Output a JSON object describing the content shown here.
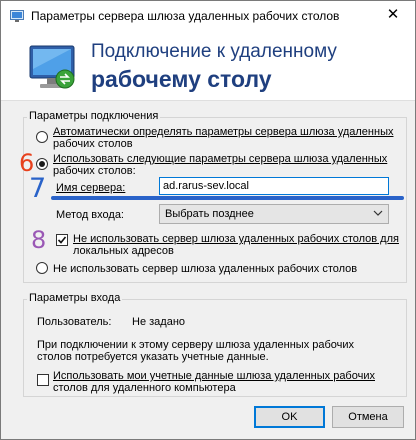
{
  "window": {
    "title": "Параметры сервера шлюза удаленных рабочих столов",
    "close_symbol": "✕"
  },
  "banner": {
    "line1": "Подключение к удаленному",
    "line2": "рабочему столу",
    "icon": "remote-desktop-monitor-icon"
  },
  "connection": {
    "group_title": "Параметры подключения",
    "option_auto": [
      "Автоматически определять параметры сервера шлюза удаленных",
      "рабочих столов"
    ],
    "option_use": [
      "Использовать следующие параметры сервера шлюза удаленных",
      "рабочих столов:"
    ],
    "server_name_label": "Имя сервера:",
    "server_name_value": "ad.rarus-sev.local",
    "login_method_label": "Метод входа:",
    "login_method_value": "Выбрать позднее",
    "bypass_local": [
      "Не использовать сервер шлюза удаленных рабочих столов для",
      "локальных адресов"
    ],
    "option_none": "Не использовать сервер шлюза удаленных рабочих столов",
    "selected_option": "use",
    "bypass_local_checked": true
  },
  "annotations": {
    "n6": "6",
    "n7": "7",
    "n8": "8",
    "colors": {
      "n6": "#e8401c",
      "n7": "#2a63c9",
      "n8": "#9a58b5"
    }
  },
  "login": {
    "group_title": "Параметры входа",
    "user_label": "Пользователь:",
    "user_value": "Не задано",
    "note": [
      "При подключении к этому серверу шлюза удаленных рабочих",
      "столов потребуется указать учетные данные."
    ],
    "use_credentials": [
      "Использовать мои учетные данные шлюза удаленных рабочих",
      "столов для удаленного компьютера"
    ],
    "use_credentials_checked": false
  },
  "buttons": {
    "ok": "OK",
    "cancel": "Отмена"
  }
}
